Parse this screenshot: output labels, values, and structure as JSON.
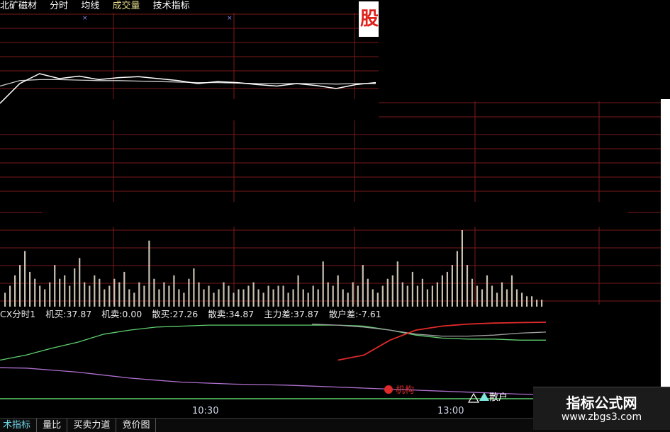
{
  "header": {
    "stock_name": "北矿磁材",
    "menu_fenshi": "分时",
    "menu_junxian": "均线",
    "menu_chengjiaoliang": "成交量",
    "menu_jishu": "技术指标"
  },
  "indicator": {
    "name": "CX分时1",
    "jimai": "机买:37.87",
    "jimai2": "机卖:0.00",
    "sanmai": "散买:27.26",
    "sanmai2": "散卖:34.87",
    "zhulicha": "主力差:37.87",
    "sanhucha": "散户差:-7.61"
  },
  "annotations": {
    "jigou": "机构",
    "sanhu": "散户"
  },
  "time_axis": {
    "t1": "10:30",
    "t2": "13:00"
  },
  "tabs": [
    {
      "label": "术指标",
      "active": true
    },
    {
      "label": "量比",
      "active": false
    },
    {
      "label": "买卖力道",
      "active": false
    },
    {
      "label": "竞价图",
      "active": false
    }
  ],
  "watermark": {
    "title": "指标公式网",
    "url": "www.zbgs3.com"
  },
  "colors": {
    "grid": "#7a1a1a",
    "price_line": "#ffffff",
    "avg_line": "#cfcfcf",
    "volume_bar": "#c9c0b0",
    "purple_line": "#b070d0",
    "green_line": "#5fcf6f",
    "red_line": "#e02a2a",
    "gray_line": "#a0a0a0",
    "teal_marker": "#7fe6e0",
    "accent_red": "#e0201a"
  },
  "chart_data": [
    {
      "type": "line",
      "title": "",
      "series": [
        {
          "values": [
            0.2,
            0.6,
            0.8,
            0.7,
            0.75,
            0.68,
            0.72,
            0.74,
            0.7,
            0.66,
            0.6,
            0.64,
            0.62,
            0.58,
            0.55,
            0.6,
            0.56,
            0.5,
            0.58,
            0.62
          ]
        },
        {
          "values": [
            0.55,
            0.66,
            0.68,
            0.68,
            0.67,
            0.66,
            0.66,
            0.65,
            0.64,
            0.63,
            0.62,
            0.62,
            0.61,
            0.6,
            0.6,
            0.6,
            0.6,
            0.59,
            0.6,
            0.6
          ]
        }
      ]
    },
    {
      "type": "bar",
      "title": "",
      "values": [
        4,
        6,
        9,
        12,
        16,
        10,
        8,
        6,
        5,
        7,
        12,
        8,
        9,
        6,
        11,
        14,
        7,
        6,
        9,
        8,
        5,
        6,
        8,
        7,
        10,
        5,
        4,
        7,
        6,
        19,
        8,
        5,
        7,
        6,
        9,
        5,
        4,
        8,
        11,
        7,
        5,
        6,
        4,
        5,
        7,
        6,
        4,
        5,
        5,
        6,
        7,
        5,
        4,
        6,
        5,
        6,
        6,
        4,
        5,
        9,
        5,
        4,
        6,
        5,
        13,
        7,
        6,
        9,
        5,
        4,
        7,
        6,
        12,
        8,
        5,
        4,
        6,
        8,
        9,
        13,
        7,
        6,
        10,
        6,
        8,
        5,
        6,
        7,
        9,
        10,
        12,
        16,
        22,
        12,
        8,
        6,
        5,
        9,
        6,
        4,
        7,
        5,
        9,
        5,
        4,
        3,
        3,
        2,
        2
      ]
    },
    {
      "type": "line",
      "title": "",
      "series": [
        {
          "values": [
            -7.6,
            -8,
            -10,
            -12,
            -15,
            -18,
            -20,
            -22,
            -23,
            -24,
            -24.5,
            -25,
            -26,
            -27,
            -28,
            -29,
            -30,
            -31,
            -32,
            -33,
            -34,
            -34.5
          ]
        },
        {
          "values": [
            0,
            5,
            12,
            18,
            26,
            30,
            33,
            34,
            35,
            35,
            35,
            35,
            35,
            35,
            34,
            30,
            25,
            22,
            21,
            21,
            20,
            20
          ]
        },
        {
          "values": [
            null,
            null,
            null,
            null,
            null,
            null,
            null,
            null,
            null,
            null,
            null,
            null,
            null,
            0,
            5,
            20,
            30,
            34,
            36,
            37,
            37.5,
            37.87
          ]
        },
        {
          "values": [
            null,
            null,
            null,
            null,
            null,
            null,
            null,
            null,
            null,
            null,
            null,
            null,
            36,
            35,
            33,
            30,
            26,
            24,
            24,
            25,
            27,
            28
          ]
        }
      ]
    }
  ]
}
